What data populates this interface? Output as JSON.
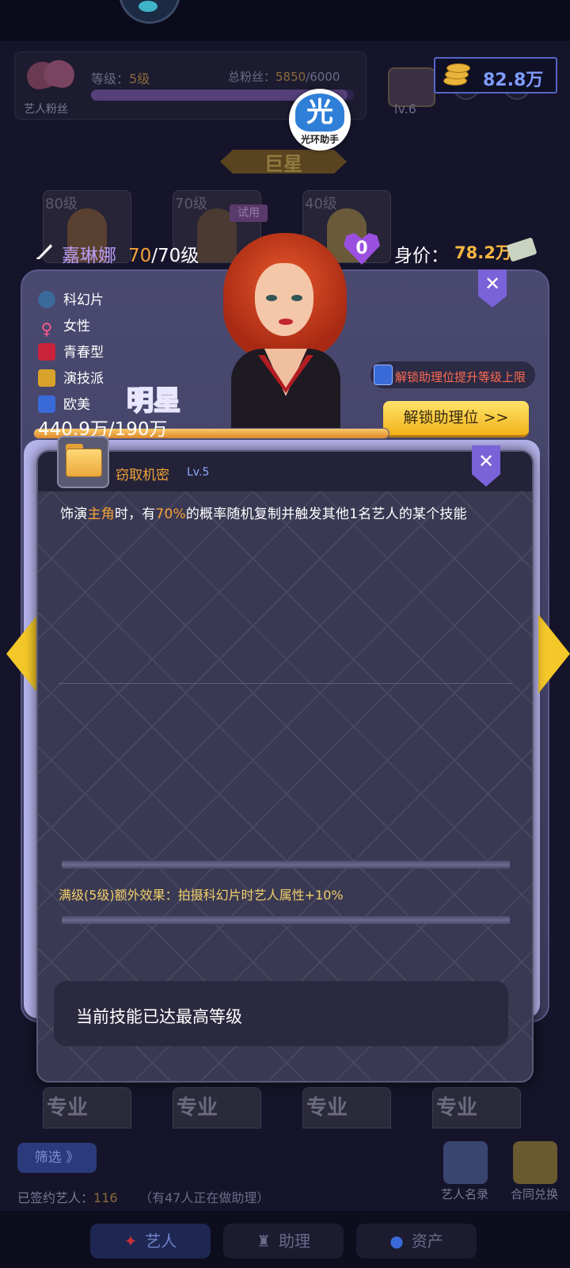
{
  "header": {
    "fans_caption": "艺人粉丝",
    "level_label": "等级：",
    "level_value": "5级",
    "total_fans_label": "总粉丝：",
    "total_fans_current": "5850",
    "total_fans_max": "/6000",
    "fans_progress": 0.975,
    "studio_level": "lv.6",
    "coins": "82.8万",
    "halo_char": "光",
    "halo_caption": "光环助手",
    "tier_label": "巨星"
  },
  "roster_top": [
    {
      "level": "80级"
    },
    {
      "level": "70级",
      "tag": "试用"
    },
    {
      "level": "40级"
    }
  ],
  "character": {
    "name": "嘉琳娜",
    "level_current": "70",
    "level_max": "/70级",
    "hearts": "0",
    "price_label": "身价：",
    "price_value": "78.2万",
    "traits": [
      "科幻片",
      "女性",
      "青春型",
      "演技派",
      "欧美"
    ],
    "rank_title": "明星",
    "exp_text": "440.9万/190万",
    "exp_progress": 1.0,
    "unlock_hint": "解锁助理位提升等级上限",
    "unlock_button": "解锁助理位 >>"
  },
  "skill_popup": {
    "name": "窃取机密",
    "level": "Lv.5",
    "desc_pre": "饰演",
    "desc_role": "主角",
    "desc_mid": "时，有",
    "desc_pct": "70%",
    "desc_post": "的概率随机复制并触发其他1名艺人的某个技能",
    "extra_effect": "满级(5级)额外效果：拍摄科幻片时艺人属性+10%",
    "max_notice": "当前技能已达最高等级"
  },
  "roster_bottom": [
    {
      "tag": "专业"
    },
    {
      "tag": "专业"
    },
    {
      "tag": "专业"
    },
    {
      "tag": "专业"
    }
  ],
  "footer": {
    "filter_button": "筛选 》",
    "signed_label": "已签约艺人：",
    "signed_count": "116",
    "signed_note": "（有47人正在做助理）",
    "directory_label": "艺人名录",
    "contract_label": "合同兑换",
    "tabs": [
      "艺人",
      "助理",
      "资产"
    ]
  },
  "colors": {
    "accent_orange": "#f7a23a",
    "purple_close": "#7a62d8",
    "gold_button": "#f2b21a",
    "coin_text": "#7f9cff"
  }
}
